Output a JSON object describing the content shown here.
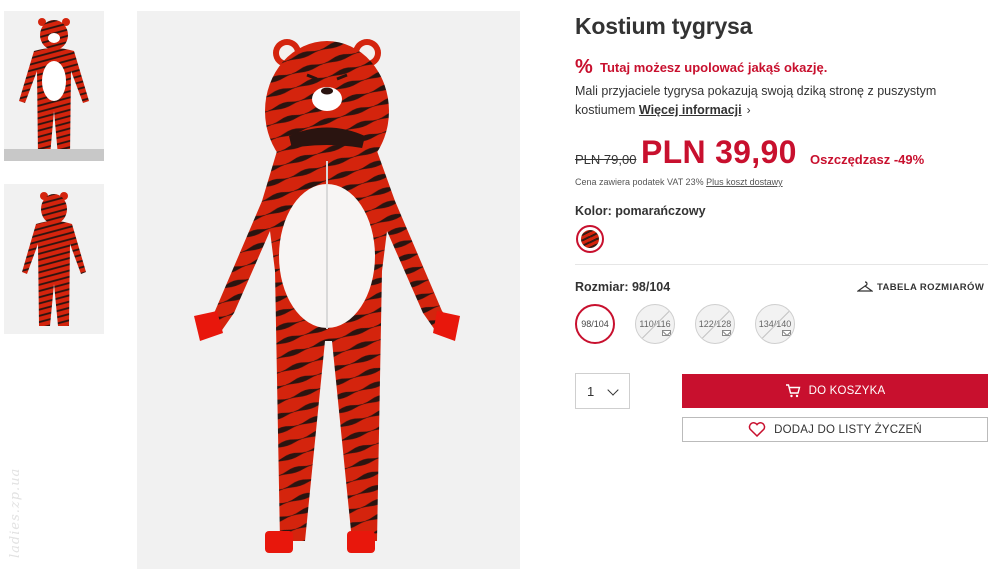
{
  "product": {
    "title": "Kostium tygrysa",
    "deal_icon": "%",
    "deal_text": "Tutaj możesz upolować jakąś okazję.",
    "description": "Mali przyjaciele tygrysa pokazują swoją dziką stronę z puszystym kostiumem",
    "more_info": "Więcej informacji",
    "old_price": "PLN 79,00",
    "price": "PLN 39,90",
    "savings": "Oszczędzasz -49%",
    "vat_text": "Cena zawiera podatek VAT 23%",
    "shipping_link": "Plus koszt dostawy"
  },
  "color": {
    "label": "Kolor: pomarańczowy",
    "swatch_name": "tiger-stripe-swatch"
  },
  "size": {
    "label": "Rozmiar: 98/104",
    "table_link": "TABELA ROZMIARÓW",
    "options": [
      {
        "label": "98/104",
        "available": true,
        "selected": true
      },
      {
        "label": "110/116",
        "available": false,
        "selected": false
      },
      {
        "label": "122/128",
        "available": false,
        "selected": false
      },
      {
        "label": "134/140",
        "available": false,
        "selected": false
      }
    ]
  },
  "quantity": {
    "value": "1"
  },
  "actions": {
    "add_to_cart": "DO KOSZYKA",
    "add_to_wishlist": "DODAJ DO LISTY ŻYCZEŃ"
  },
  "watermark": "ladies.zp.ua",
  "colors": {
    "accent": "#c8102e",
    "costume_red": "#d4240d",
    "stripe": "#2a1410",
    "image_bg": "#f1f1f1"
  },
  "icons": [
    "percent-icon",
    "chevron-right-icon",
    "hanger-icon",
    "cart-icon",
    "heart-icon",
    "chevron-down-icon",
    "mail-icon"
  ]
}
